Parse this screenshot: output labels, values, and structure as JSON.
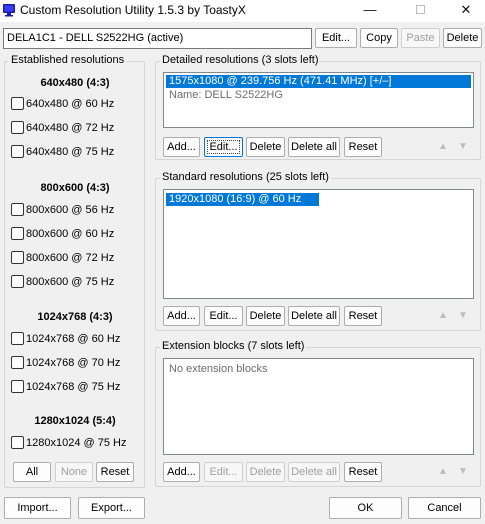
{
  "window": {
    "title": "Custom Resolution Utility 1.5.3 by ToastyX",
    "minimize_glyph": "—",
    "close_glyph": "✕"
  },
  "toolbar": {
    "monitor_selected": "DELA1C1 - DELL S2522HG (active)",
    "edit": "Edit...",
    "copy": "Copy",
    "paste": "Paste",
    "delete": "Delete"
  },
  "established": {
    "title": "Established resolutions",
    "groups": [
      {
        "heading": "640x480 (4:3)",
        "items": [
          "640x480 @ 60 Hz",
          "640x480 @ 72 Hz",
          "640x480 @ 75 Hz"
        ]
      },
      {
        "heading": "800x600 (4:3)",
        "items": [
          "800x600 @ 56 Hz",
          "800x600 @ 60 Hz",
          "800x600 @ 72 Hz",
          "800x600 @ 75 Hz"
        ]
      },
      {
        "heading": "1024x768 (4:3)",
        "items": [
          "1024x768 @ 60 Hz",
          "1024x768 @ 70 Hz",
          "1024x768 @ 75 Hz"
        ]
      },
      {
        "heading": "1280x1024 (5:4)",
        "items": [
          "1280x1024 @ 75 Hz"
        ]
      }
    ],
    "all": "All",
    "none": "None",
    "reset": "Reset"
  },
  "detailed": {
    "title": "Detailed resolutions (3 slots left)",
    "items": [
      "1575x1080 @ 239.756 Hz (471.41 MHz) [+/–]",
      "Name: DELL S2522HG"
    ],
    "add": "Add...",
    "edit": "Edit...",
    "delete": "Delete",
    "delete_all": "Delete all",
    "reset": "Reset"
  },
  "standard": {
    "title": "Standard resolutions (25 slots left)",
    "items": [
      "1920x1080 (16:9) @ 60 Hz"
    ],
    "add": "Add...",
    "edit": "Edit...",
    "delete": "Delete",
    "delete_all": "Delete all",
    "reset": "Reset"
  },
  "extension": {
    "title": "Extension blocks (7 slots left)",
    "empty_text": "No extension blocks",
    "add": "Add...",
    "edit": "Edit...",
    "delete": "Delete",
    "delete_all": "Delete all",
    "reset": "Reset"
  },
  "arrows": {
    "up": "▲",
    "down": "▼"
  },
  "footer": {
    "import": "Import...",
    "export": "Export...",
    "ok": "OK",
    "cancel": "Cancel"
  },
  "colors": {
    "selection": "#0078d7",
    "titlebar": "#ffffff",
    "window": "#f0f0f0"
  }
}
